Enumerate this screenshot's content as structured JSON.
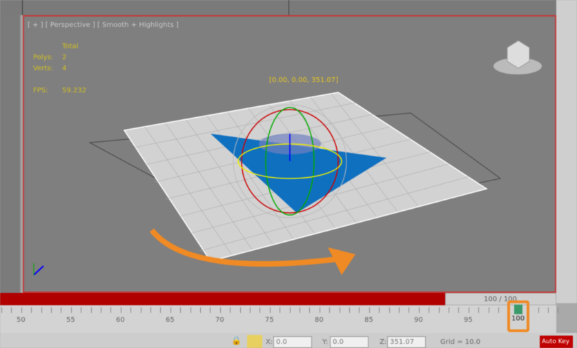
{
  "viewport": {
    "label": "[ + ] [ Perspective ] [ Smooth + Highlights ]",
    "stats": {
      "header": "Total",
      "polys_label": "Polys:",
      "polys": "2",
      "verts_label": "Verts:",
      "verts": "4",
      "fps_label": "FPS:",
      "fps": "59.232"
    },
    "gizmo_coords": "[0.00, 0.00, 351.07]"
  },
  "timeline": {
    "slider_label": "100 / 100",
    "ticks": [
      "50",
      "55",
      "60",
      "65",
      "70",
      "75",
      "80",
      "85",
      "90",
      "95"
    ],
    "current_frame": "100"
  },
  "status": {
    "x_label": "X:",
    "x": "0.0",
    "y_label": "Y:",
    "y": "0.0",
    "z_label": "Z:",
    "z": "351.07",
    "grid": "Grid = 10.0",
    "autokey": "Auto Key"
  },
  "colors": {
    "accent": "#f08a24",
    "active_border": "#c23a3a",
    "timebar": "#b00000",
    "object": "#1070c0"
  }
}
